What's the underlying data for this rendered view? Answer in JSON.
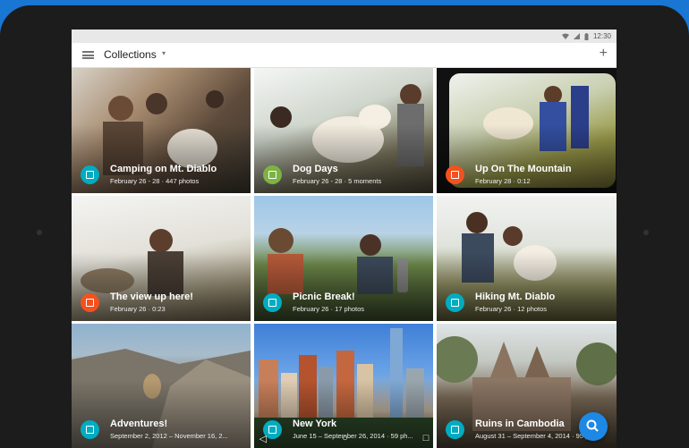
{
  "status": {
    "time": "12:30",
    "icons": [
      "wifi-icon",
      "signal-icon",
      "battery-icon"
    ]
  },
  "appbar": {
    "title": "Collections",
    "caret": "▾",
    "add": "+"
  },
  "tiles": [
    {
      "title": "Camping on Mt. Diablo",
      "subtitle": "February 26 - 28 · 447 photos",
      "badge": "album-icon",
      "badge_color": "#00acc1"
    },
    {
      "title": "Dog Days",
      "subtitle": "February 26 - 28 · 5 moments",
      "badge": "story-icon",
      "badge_color": "#7cb342"
    },
    {
      "title": "Up On The Mountain",
      "subtitle": "February 28 · 0:12",
      "badge": "movie-icon",
      "badge_color": "#f4511e"
    },
    {
      "title": "The view up here!",
      "subtitle": "February 26 · 0:23",
      "badge": "movie-icon",
      "badge_color": "#f4511e"
    },
    {
      "title": "Picnic Break!",
      "subtitle": "February 26 · 17 photos",
      "badge": "album-icon",
      "badge_color": "#00acc1"
    },
    {
      "title": "Hiking Mt. Diablo",
      "subtitle": "February 26 · 12 photos",
      "badge": "album-icon",
      "badge_color": "#00acc1"
    },
    {
      "title": "Adventures!",
      "subtitle": "September 2, 2012 – November 16, 2...",
      "badge": "album-icon",
      "badge_color": "#00acc1"
    },
    {
      "title": "New York",
      "subtitle": "June 15 – September 26, 2014 · 59 ph...",
      "badge": "album-icon",
      "badge_color": "#00acc1"
    },
    {
      "title": "Ruins in Cambodia",
      "subtitle": "August 31 – September 4, 2014 · 95 ph...",
      "badge": "album-icon",
      "badge_color": "#00acc1"
    }
  ],
  "fab": {
    "icon": "search-icon",
    "color": "#1e88e5"
  },
  "nav": {
    "back": "◁",
    "home": "○",
    "recents": "□"
  }
}
